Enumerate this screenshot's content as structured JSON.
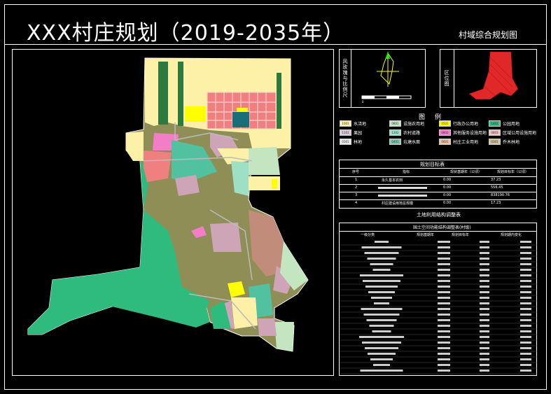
{
  "header": {
    "title": "XXX村庄规划（2019-2035年）",
    "subtitle": "村域综合规划图"
  },
  "inset_left": {
    "label": "风玫瑰与比例尺"
  },
  "inset_right": {
    "label": "区位图"
  },
  "legend": {
    "title": "图例",
    "items": [
      {
        "code": "1001",
        "label": "水浇地",
        "color": "#fdf1a8"
      },
      {
        "code": "0801",
        "label": "设施农用地",
        "color": "#c3e6c0"
      },
      {
        "code": "0501",
        "label": "行政办公用地",
        "color": "#ffff00"
      },
      {
        "code": "1402",
        "label": "公园用地",
        "color": "#2ebb7d"
      },
      {
        "code": "1101",
        "label": "果园",
        "color": "#d7c9d8"
      },
      {
        "code": "1202",
        "label": "农村道路",
        "color": "#9ee0c6"
      },
      {
        "code": "0802",
        "label": "其他服务设施用地",
        "color": "#f37ec7"
      },
      {
        "code": "0803",
        "label": "区域公用设施用地",
        "color": "#f4c1c8"
      },
      {
        "code": "0301",
        "label": "林地",
        "color": "#e8e8e8"
      },
      {
        "code": "0401",
        "label": "坑塘水面",
        "color": "#7fc7b0"
      },
      {
        "code": "0601",
        "label": "村庄工业用地",
        "color": "#f2c29f"
      },
      {
        "code": "0301",
        "label": "乔木林地",
        "color": "#cfc09e"
      }
    ]
  },
  "targets": {
    "title": "规划目标表",
    "headers": [
      "序号",
      "指标",
      "现状基期年（公顷）",
      "规划目标年（公顷）"
    ],
    "rows": [
      {
        "no": "1",
        "name": "永久基本农田",
        "base": "0.00",
        "target": "37.23"
      },
      {
        "no": "2",
        "name": "",
        "base": "0.00",
        "target": "556.45"
      },
      {
        "no": "3",
        "name": "",
        "base": "0.00",
        "target": "838190.76"
      },
      {
        "no": "4",
        "name": "村庄建设用地总规模",
        "base": "0.00",
        "target": "17.23"
      }
    ]
  },
  "landuse": {
    "title": "土地利用结构调整表",
    "subtitle": "国土空间功能结构调整表(村级)",
    "headers": [
      "一级分类",
      "规划基期年",
      "规划目标年",
      "规划期内变化"
    ]
  },
  "colors": {
    "agri_yellow": "#fdf1a8",
    "forest_olive": "#8f8e57",
    "park_green": "#2ebb7d",
    "pink": "#f37ec7",
    "red": "#f08080",
    "teal": "#52c1a0",
    "mauve": "#cda5b6",
    "brown": "#c28c7a",
    "dark_green": "#2c7a3e",
    "red_region": "#e02828"
  }
}
